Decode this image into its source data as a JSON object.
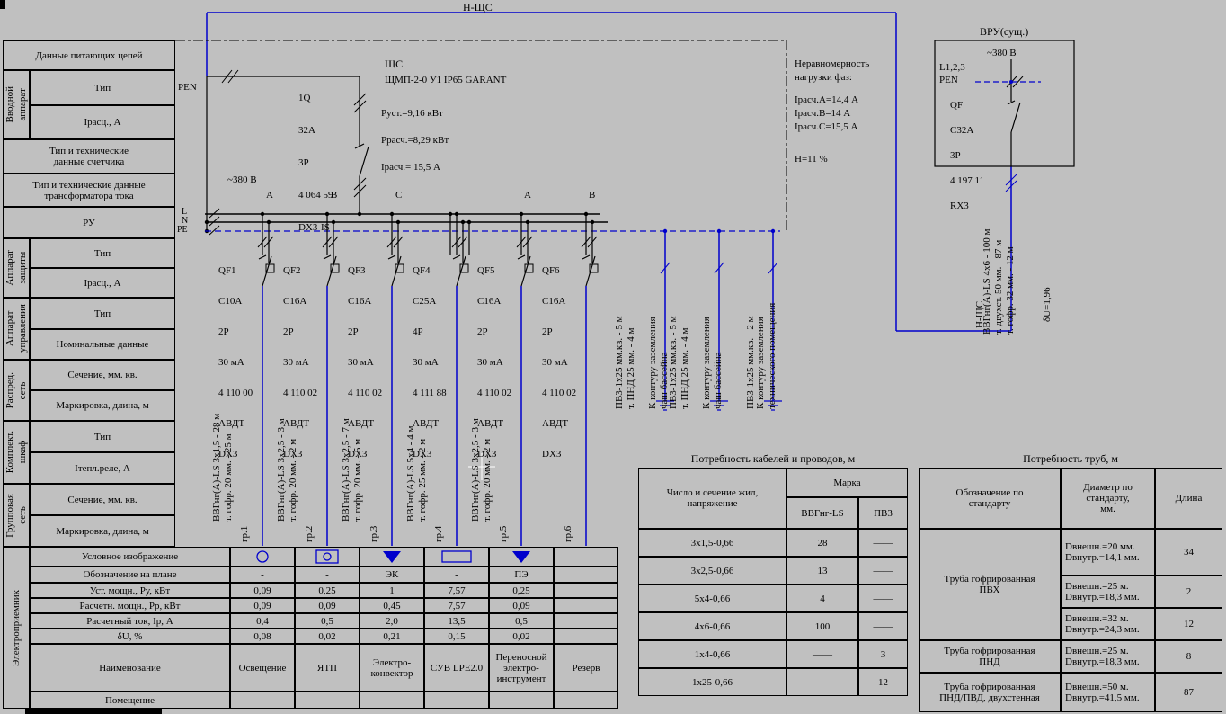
{
  "colors": {
    "bg": "#c0c0c0",
    "line": "#000000",
    "cable": "#0000cc",
    "cursor": "#ffffff"
  },
  "title_bus": "Н-ЩС",
  "left_table": {
    "top": "Данные питающих цепей",
    "vvod_cat": "Вводной\nаппарат",
    "vvod_r1": "Тип",
    "vvod_r2": "Iрасц., А",
    "meter": "Тип и технические\nданные счетчика",
    "ct": "Тип и технические данные\nтрансформатора тока",
    "ru": "РУ",
    "prot_cat": "Аппарат\nзащиты",
    "prot_r1": "Тип",
    "prot_r2": "Iрасц., А",
    "ctrl_cat": "Аппарат\nуправления",
    "ctrl_r1": "Тип",
    "ctrl_r2": "Номинальные данные",
    "dist_cat": "Распред.\nсеть",
    "dist_r1": "Сечение, мм. кв.",
    "dist_r2": "Маркировка, длина, м",
    "cab_cat": "Комплект.\nшкаф",
    "cab_r1": "Тип",
    "cab_r2": "Iтепл.реле, А",
    "grp_cat": "Групповая\nсеть",
    "grp_r1": "Сечение, мм. кв.",
    "grp_r2": "Маркировка, длина, м",
    "cons_cat": "Электроприемник",
    "cons_r1": "Условное изображение",
    "cons_r2": "Обозначение на плане",
    "cons_r3": "Уст. мощн., Ру, кВт",
    "cons_r4": "Расчетн. мощн., Рр, кВт",
    "cons_r5": "Расчетный ток, Iр, А",
    "cons_r6": "δU, %",
    "cons_r7": "Наименование",
    "cons_r8": "Помещение"
  },
  "panel": {
    "name": "ЩС",
    "type": "ЩМП-2-0 У1 IP65 GARANT",
    "p_ust": "Руст.=9,16 кВт",
    "p_calc": "Ррасч.=8,29 кВт",
    "i_calc": "Iрасч.= 15,5 А",
    "pen": "PEN",
    "voltage": "~380 В",
    "in_tag": "1Q",
    "in_cur": "32A",
    "in_poles": "3P",
    "in_art": "4 064 59",
    "in_series": "DX3-IS",
    "bus_l": "L",
    "bus_n": "N",
    "bus_pe": "PE",
    "ph1": "A",
    "ph2": "B",
    "ph3": "C",
    "ph4": "A",
    "ph5": "B"
  },
  "breakers": [
    {
      "tag": "QF1",
      "cur": "C10A",
      "poles": "2P",
      "leak": "30 мА",
      "art": "4 110 00",
      "kind": "АВДТ",
      "series": "DX3"
    },
    {
      "tag": "QF2",
      "cur": "C16A",
      "poles": "2P",
      "leak": "30 мА",
      "art": "4 110 02",
      "kind": "АВДТ",
      "series": "DX3"
    },
    {
      "tag": "QF3",
      "cur": "C16A",
      "poles": "2P",
      "leak": "30 мА",
      "art": "4 110 02",
      "kind": "АВДТ",
      "series": "DX3"
    },
    {
      "tag": "QF4",
      "cur": "C25A",
      "poles": "4P",
      "leak": "30 мА",
      "art": "4 111 88",
      "kind": "АВДТ",
      "series": "DX3"
    },
    {
      "tag": "QF5",
      "cur": "C16A",
      "poles": "2P",
      "leak": "30 мА",
      "art": "4 110 02",
      "kind": "АВДТ",
      "series": "DX3"
    },
    {
      "tag": "QF6",
      "cur": "C16A",
      "poles": "2P",
      "leak": "30 мА",
      "art": "4 110 02",
      "kind": "АВДТ",
      "series": "DX3"
    }
  ],
  "groups": [
    {
      "num": "гр.1",
      "cable": "ВВГнг(А)-LS 3х1,5 - 28 м\nт. гофр. 20 мм. - 25 м"
    },
    {
      "num": "гр.2",
      "cable": "ВВГнг(А)-LS 3х2,5 - 3 м\nт. гофр. 20 мм. - 2 м"
    },
    {
      "num": "гр.3",
      "cable": "ВВГнг(А)-LS 3х2,5 - 7 м\nт. гофр. 20 мм. - 5 м"
    },
    {
      "num": "гр.4",
      "cable": "ВВГнг(А)-LS 5х4 - 4 м\nт. гофр. 25 мм. - 2 м"
    },
    {
      "num": "гр.5",
      "cable": "ВВГнг(А)-LS 3х2,5 - 3 м\nт. гофр. 20 мм. - 2 м"
    },
    {
      "num": "гр.6",
      "cable": ""
    }
  ],
  "grounds": [
    {
      "wire": "ПВ3-1х25 мм.кв. - 5 м\nт. ПНД 25 мм. - 4 м",
      "dest": "К контуру заземления\nчаш бассейна"
    },
    {
      "wire": "ПВ3-1х25 мм.кв. - 5 м\nт. ПНД 25 мм. - 4 м",
      "dest": "К контуру заземления\nчаш бассейна"
    },
    {
      "wire": "ПВ3-1х25 мм.кв. - 2 м",
      "dest": "К контуру заземления\nтехнического помещения"
    }
  ],
  "imbalance": {
    "title": "Неравномерность\nнагрузки фаз:",
    "ia": "Iрасч.А=14,4 А",
    "ib": "Iрасч.В=14 А",
    "ic": "Iрасч.С=15,5 А",
    "h": "Н=11 %"
  },
  "vru": {
    "title": "ВРУ(сущ.)",
    "voltage": "~380 В",
    "lines": "L1,2,3",
    "pen": "PEN",
    "tag": "QF",
    "cur": "C32A",
    "poles": "3P",
    "art": "4 197 11",
    "series": "RX3",
    "cable": "ВВГнг(А)-LS 4х6 - 100 м\nт. двухст. 50 мм. - 87 м\nт. гофр. 32 мм. - 12 м",
    "du": "δU=1,96",
    "riser": "Н-ЩС"
  },
  "consumers": {
    "designation": [
      "-",
      "-",
      "ЭК",
      "-",
      "ПЭ",
      ""
    ],
    "p_inst": [
      "0,09",
      "0,25",
      "1",
      "7,57",
      "0,25",
      ""
    ],
    "p_calc": [
      "0,09",
      "0,09",
      "0,45",
      "7,57",
      "0,09",
      ""
    ],
    "current": [
      "0,4",
      "0,5",
      "2,0",
      "13,5",
      "0,5",
      ""
    ],
    "du": [
      "0,08",
      "0,02",
      "0,21",
      "0,15",
      "0,02",
      ""
    ],
    "names": [
      "Освещение",
      "ЯТП",
      "Электро-\nконвектор",
      "СУВ LPE2.0",
      "Переносной\nэлектро-\nинструмент",
      "Резерв"
    ],
    "rooms": [
      "-",
      "-",
      "-",
      "-",
      "-",
      ""
    ]
  },
  "cables_table": {
    "title": "Потребность кабелей и проводов, м",
    "col_size": "Число и сечение жил,\nнапряжение",
    "col_brand": "Марка",
    "brand1": "ВВГнг-LS",
    "brand2": "ПВ3",
    "rows": [
      {
        "s": "3х1,5-0,66",
        "v1": "28",
        "v2": "——"
      },
      {
        "s": "3х2,5-0,66",
        "v1": "13",
        "v2": "——"
      },
      {
        "s": "5х4-0,66",
        "v1": "4",
        "v2": "——"
      },
      {
        "s": "4х6-0,66",
        "v1": "100",
        "v2": "——"
      },
      {
        "s": "1х4-0,66",
        "v1": "——",
        "v2": "3"
      },
      {
        "s": "1х25-0,66",
        "v1": "——",
        "v2": "12"
      }
    ]
  },
  "pipes_table": {
    "title": "Потребность труб, м",
    "h_std": "Обозначение по\nстандарту",
    "h_dia": "Диаметр по\nстандарту,\nмм.",
    "h_len": "Длина",
    "pvh": "Труба гофрированная\nПВХ",
    "pnd": "Труба гофрированная\nПНД",
    "pnd2": "Труба гофрированная\nПНД/ПВД, двухстенная",
    "rows": [
      {
        "d": "Dвнешн.=20 мм.\nDвнутр.=14,1 мм.",
        "len": "34"
      },
      {
        "d": "Dвнешн.=25 м.\nDвнутр.=18,3 мм.",
        "len": "2"
      },
      {
        "d": "Dвнешн.=32 м.\nDвнутр.=24,3 мм.",
        "len": "12"
      },
      {
        "d": "Dвнешн.=25 м.\nDвнутр.=18,3 мм.",
        "len": "8"
      },
      {
        "d": "Dвнешн.=50 м.\nDвнутр.=41,5 мм.",
        "len": "87"
      }
    ]
  }
}
